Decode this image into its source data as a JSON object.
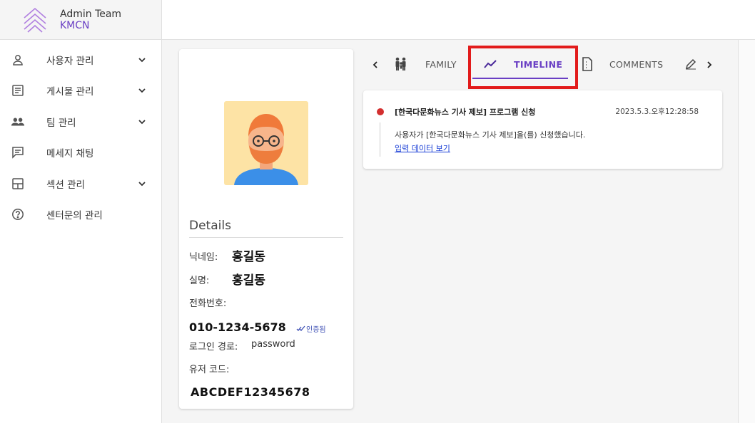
{
  "brand": {
    "title": "Admin Team",
    "subtitle": "KMCN",
    "accent": "#6a3fc4"
  },
  "sidebar": {
    "items": [
      {
        "label": "사용자 관리",
        "icon": "person-icon",
        "expandable": true
      },
      {
        "label": "게시물 관리",
        "icon": "article-icon",
        "expandable": true
      },
      {
        "label": "팀 관리",
        "icon": "group-icon",
        "expandable": true
      },
      {
        "label": "메세지 채팅",
        "icon": "chat-icon",
        "expandable": false
      },
      {
        "label": "섹션 관리",
        "icon": "layout-icon",
        "expandable": true
      },
      {
        "label": "센터문의 관리",
        "icon": "help-icon",
        "expandable": false
      }
    ]
  },
  "profile": {
    "details_title": "Details",
    "nickname_label": "닉네임:",
    "nickname": "홍길동",
    "realname_label": "실명:",
    "realname": "홍길동",
    "phone_label": "전화번호:",
    "phone": "010-1234-5678",
    "verified_label": "인증됨",
    "login_label": "로그인 경로:",
    "login_value": "password",
    "usercode_label": "유저 코드:",
    "usercode": "ABCDEF12345678"
  },
  "tabs": {
    "items": [
      {
        "label": "FAMILY",
        "icon": "family-icon"
      },
      {
        "label": "TIMELINE",
        "icon": "timeline-icon",
        "active": true
      },
      {
        "label": "COMMENTS",
        "icon": "document-icon"
      },
      {
        "label": "",
        "icon": "edit-icon"
      }
    ]
  },
  "timeline": {
    "entries": [
      {
        "title": "[한국다문화뉴스 기사 제보] 프로그램 신청",
        "time": "2023.5.3.오후12:28:58",
        "description": "사용자가 [한국다문화뉴스 기사 제보]을(를) 신청했습니다.",
        "link": "입력 데이터 보기",
        "status_color": "#d32f2f"
      }
    ]
  }
}
